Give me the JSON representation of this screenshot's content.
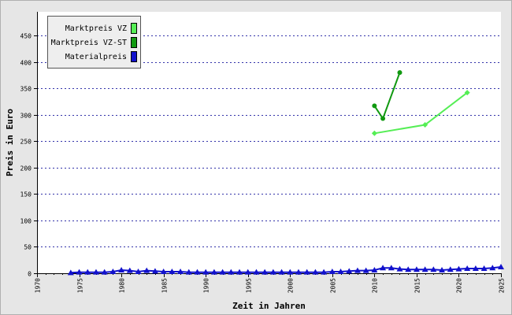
{
  "chart_data": {
    "type": "line",
    "title": "",
    "xlabel": "Zeit in Jahren",
    "ylabel": "Preis in Euro",
    "xlim": [
      1970,
      2025
    ],
    "ylim": [
      0,
      495
    ],
    "x_ticks": [
      1970,
      1975,
      1980,
      1985,
      1990,
      1995,
      2000,
      2005,
      2010,
      2015,
      2020,
      2025
    ],
    "y_ticks": [
      0,
      50,
      100,
      150,
      200,
      250,
      300,
      350,
      400,
      450
    ],
    "grid": "horizontal dotted",
    "legend_position": "top-left",
    "series": [
      {
        "name": "Marktpreis VZ",
        "color": "#55ee55",
        "marker": "diamond",
        "points": [
          [
            2010,
            265
          ],
          [
            2016,
            281
          ],
          [
            2021,
            342
          ]
        ]
      },
      {
        "name": "Marktpreis VZ-ST",
        "color": "#119911",
        "marker": "circle",
        "points": [
          [
            2010,
            317
          ],
          [
            2011,
            293
          ],
          [
            2013,
            380
          ]
        ]
      },
      {
        "name": "Materialpreis",
        "color": "#1111cc",
        "marker": "triangle",
        "points": [
          [
            1974,
            1
          ],
          [
            1975,
            2
          ],
          [
            1976,
            2
          ],
          [
            1977,
            2
          ],
          [
            1978,
            2
          ],
          [
            1979,
            3
          ],
          [
            1980,
            6
          ],
          [
            1981,
            5
          ],
          [
            1982,
            3
          ],
          [
            1983,
            5
          ],
          [
            1984,
            4
          ],
          [
            1985,
            3
          ],
          [
            1986,
            3
          ],
          [
            1987,
            3
          ],
          [
            1988,
            2
          ],
          [
            1989,
            2
          ],
          [
            1990,
            2
          ],
          [
            1991,
            2
          ],
          [
            1992,
            2
          ],
          [
            1993,
            2
          ],
          [
            1994,
            2
          ],
          [
            1995,
            2
          ],
          [
            1996,
            2
          ],
          [
            1997,
            2
          ],
          [
            1998,
            2
          ],
          [
            1999,
            2
          ],
          [
            2000,
            2
          ],
          [
            2001,
            2
          ],
          [
            2002,
            2
          ],
          [
            2003,
            2
          ],
          [
            2004,
            2
          ],
          [
            2005,
            3
          ],
          [
            2006,
            3
          ],
          [
            2007,
            4
          ],
          [
            2008,
            5
          ],
          [
            2009,
            5
          ],
          [
            2010,
            6
          ],
          [
            2011,
            10
          ],
          [
            2012,
            10
          ],
          [
            2013,
            8
          ],
          [
            2014,
            7
          ],
          [
            2015,
            7
          ],
          [
            2016,
            7
          ],
          [
            2017,
            7
          ],
          [
            2018,
            6
          ],
          [
            2019,
            7
          ],
          [
            2020,
            8
          ],
          [
            2021,
            9
          ],
          [
            2022,
            9
          ],
          [
            2023,
            9
          ],
          [
            2024,
            10
          ],
          [
            2025,
            12
          ]
        ]
      }
    ]
  }
}
